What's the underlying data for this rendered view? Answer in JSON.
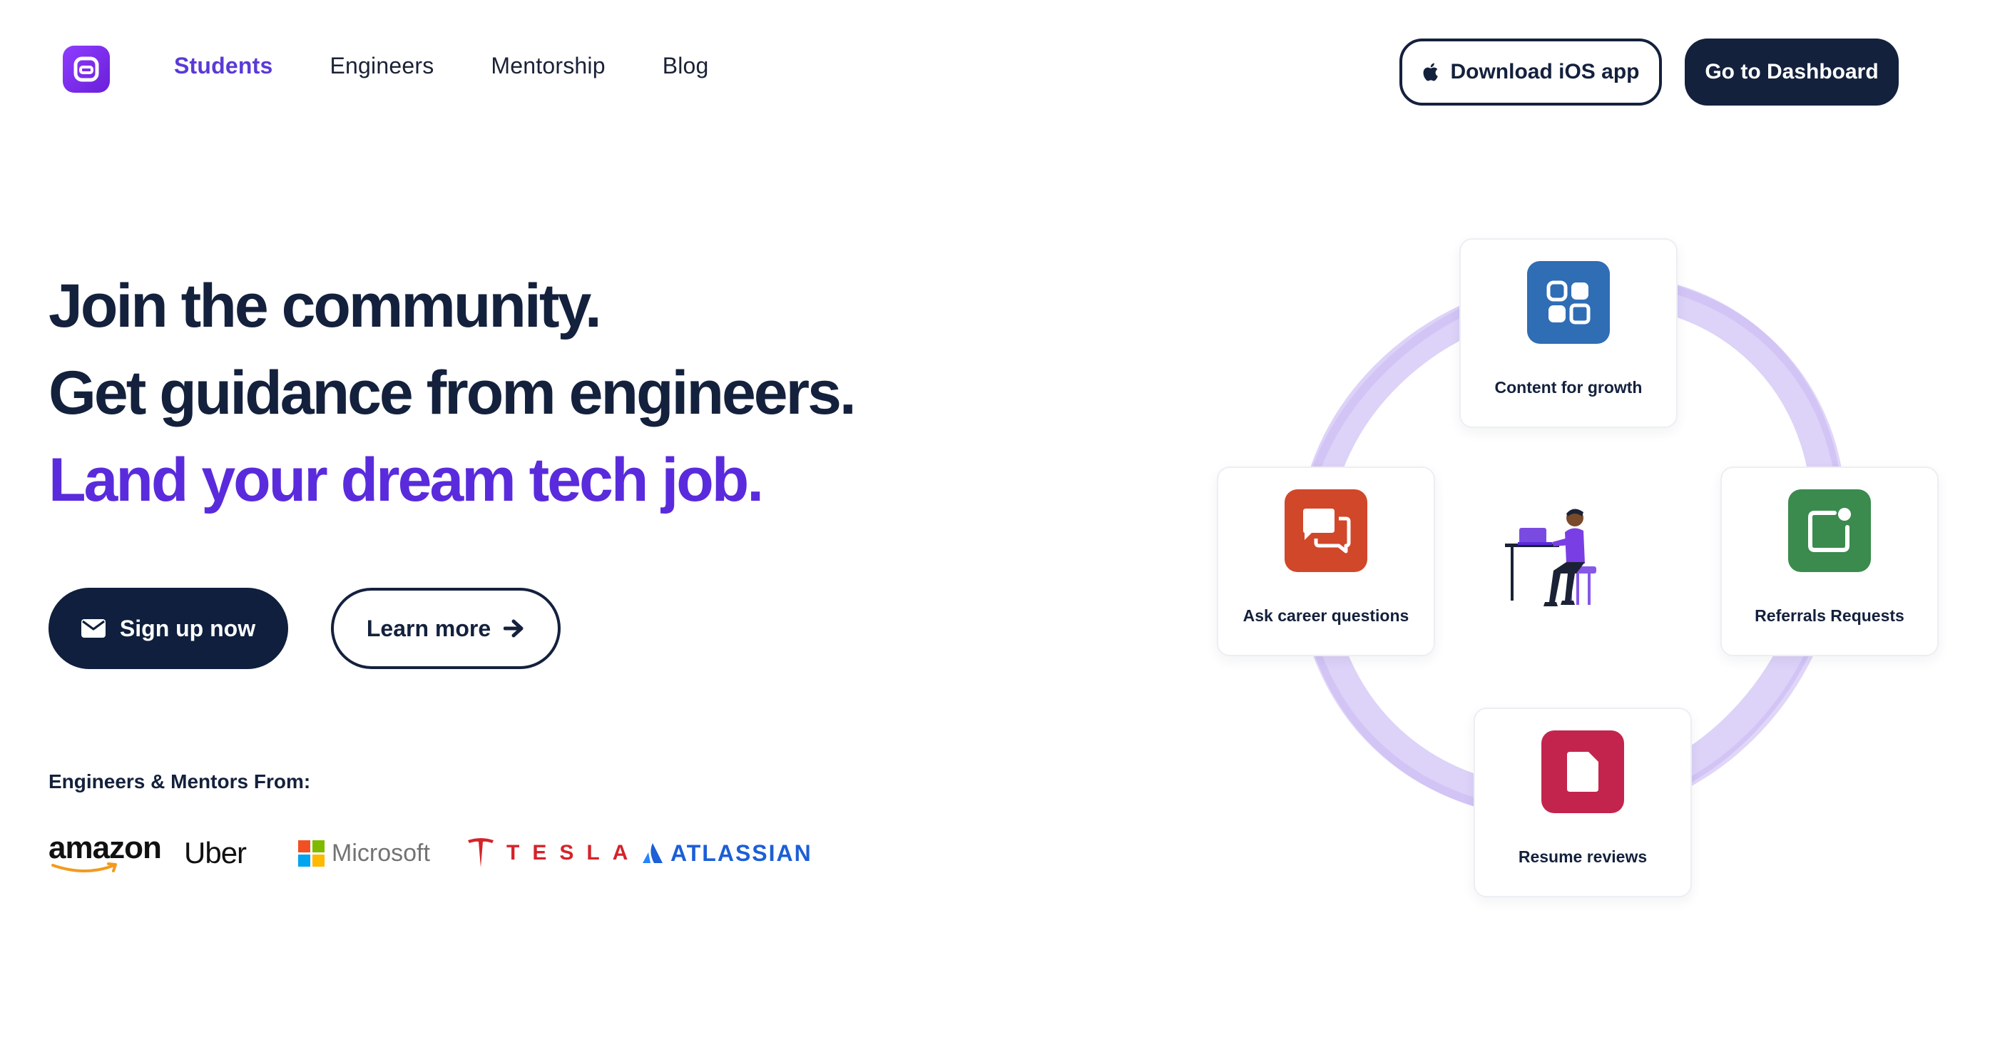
{
  "nav": {
    "links": [
      {
        "label": "Students",
        "active": true
      },
      {
        "label": "Engineers",
        "active": false
      },
      {
        "label": "Mentorship",
        "active": false
      },
      {
        "label": "Blog",
        "active": false
      }
    ],
    "ios_button": "Download iOS app",
    "dashboard_button": "Go to Dashboard"
  },
  "hero": {
    "line1": "Join the community.",
    "line2": "Get guidance from engineers.",
    "line3": "Land your dream tech job.",
    "signup_button": "Sign up now",
    "learn_button": "Learn more",
    "mentors_label": "Engineers & Mentors From:"
  },
  "companies": {
    "amazon": "amazon",
    "uber": "Uber",
    "microsoft": "Microsoft",
    "tesla": "TESLA",
    "atlassian": "ATLASSIAN"
  },
  "features": {
    "top": "Content for growth",
    "left": "Ask career questions",
    "right": "Referrals Requests",
    "bottom": "Resume reviews"
  },
  "colors": {
    "accent": "#5a2bdc",
    "navy": "#14213d",
    "content_icon": "#2f6db5",
    "questions_icon": "#d1472a",
    "referrals_icon": "#3a8b4d",
    "resume_icon": "#c3244d",
    "ring": "#d9cdf7"
  },
  "icons": {
    "logo": "app-logo-icon",
    "apple": "apple-icon",
    "mail": "mail-icon",
    "arrow": "arrow-right-icon",
    "grid": "grid-icon",
    "chat": "chat-icon",
    "referral": "referral-icon",
    "document": "document-icon"
  }
}
